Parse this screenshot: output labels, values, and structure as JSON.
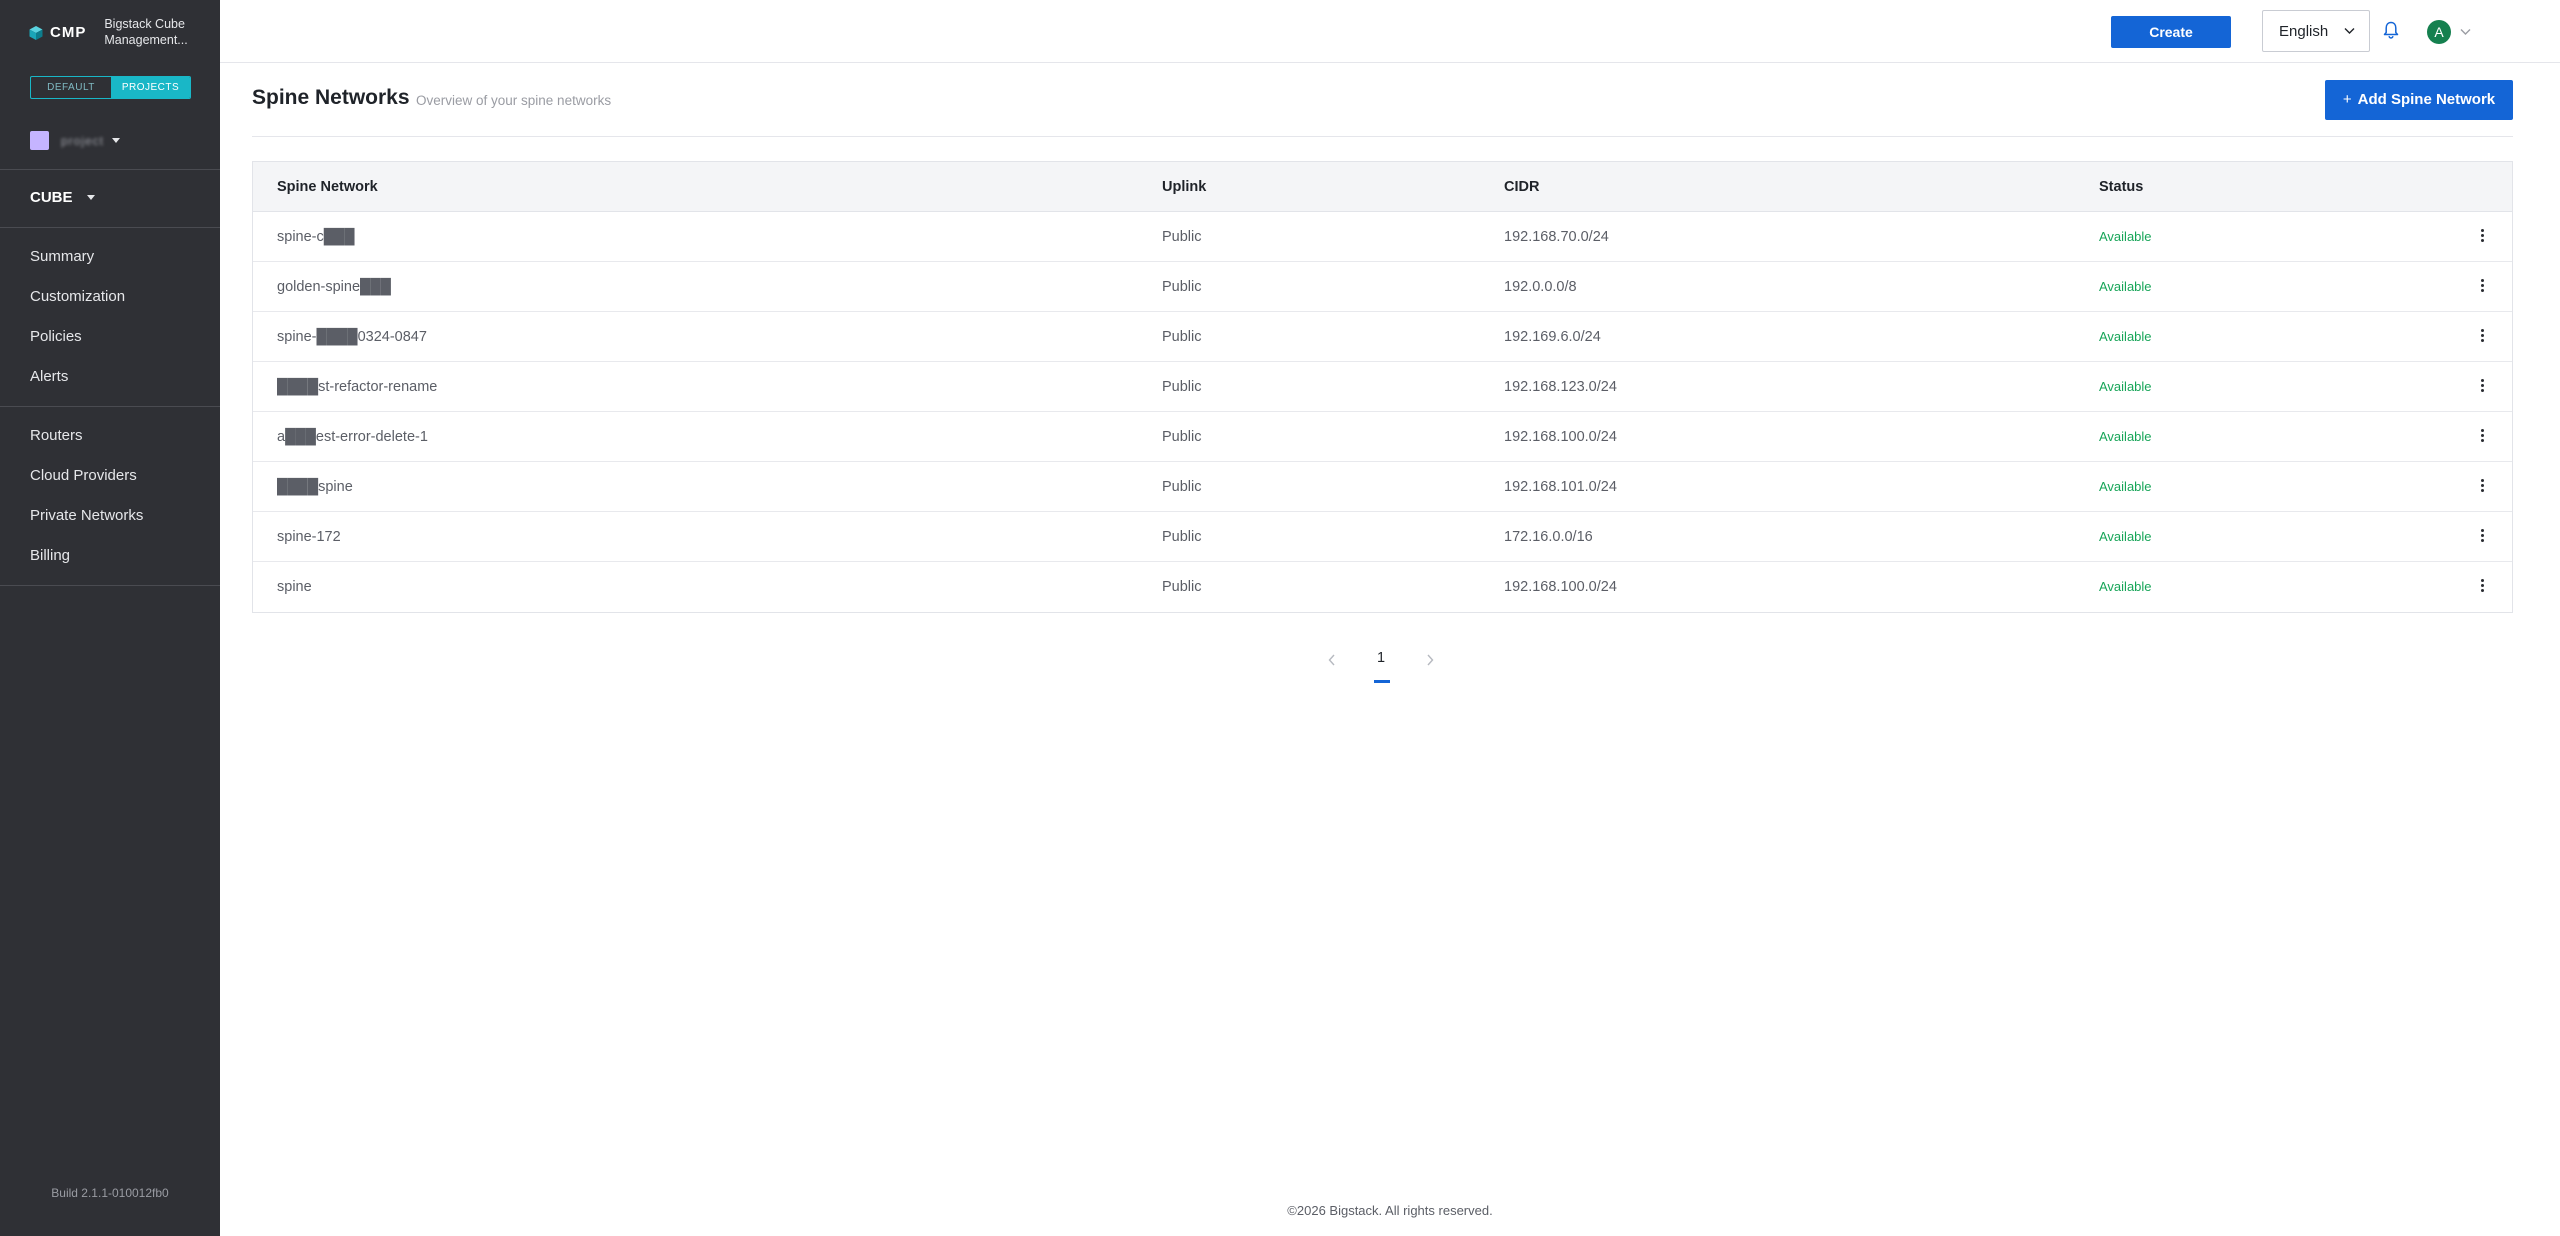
{
  "sidebar": {
    "brand": {
      "logo_text": "CMP",
      "app_name": "Bigstack Cube Management..."
    },
    "scope": {
      "default_label": "DEFAULT",
      "projects_label": "PROJECTS"
    },
    "project": {
      "name": "project",
      "swatch_color": "#c5b4ff"
    },
    "cube_selector": "CUBE",
    "nav_group_1": [
      {
        "label": "Summary"
      },
      {
        "label": "Customization"
      },
      {
        "label": "Policies"
      },
      {
        "label": "Alerts"
      }
    ],
    "nav_group_2": [
      {
        "label": "Routers"
      },
      {
        "label": "Cloud Providers"
      },
      {
        "label": "Private Networks"
      },
      {
        "label": "Billing"
      }
    ],
    "build": "Build 2.1.1-010012fb0"
  },
  "header": {
    "create_label": "Create",
    "language": "English",
    "avatar_initial": "A"
  },
  "page": {
    "title": "Spine Networks",
    "subtitle": "Overview of your spine networks",
    "add_label": "Add Spine Network"
  },
  "table": {
    "columns": [
      "Spine Network",
      "Uplink",
      "CIDR",
      "Status"
    ],
    "rows": [
      {
        "name": "spine-c███",
        "uplink": "Public",
        "cidr": "192.168.70.0/24",
        "status": "Available"
      },
      {
        "name": "golden-spine███",
        "uplink": "Public",
        "cidr": "192.0.0.0/8",
        "status": "Available"
      },
      {
        "name": "spine-████0324-0847",
        "uplink": "Public",
        "cidr": "192.169.6.0/24",
        "status": "Available"
      },
      {
        "name": "████st-refactor-rename",
        "uplink": "Public",
        "cidr": "192.168.123.0/24",
        "status": "Available"
      },
      {
        "name": "a███est-error-delete-1",
        "uplink": "Public",
        "cidr": "192.168.100.0/24",
        "status": "Available"
      },
      {
        "name": "████spine",
        "uplink": "Public",
        "cidr": "192.168.101.0/24",
        "status": "Available"
      },
      {
        "name": "spine-172",
        "uplink": "Public",
        "cidr": "172.16.0.0/16",
        "status": "Available"
      },
      {
        "name": "spine",
        "uplink": "Public",
        "cidr": "192.168.100.0/24",
        "status": "Available"
      }
    ]
  },
  "pagination": {
    "current_page": "1"
  },
  "footer": {
    "copyright": "©2026 Bigstack. All rights reserved."
  },
  "colors": {
    "sidebar_bg": "#2f3035",
    "primary": "#1465d6",
    "accent_teal": "#19b7c7",
    "status_available": "#17a558",
    "avatar_bg": "#15804f"
  },
  "icons": {
    "logo": "cube-logo-icon",
    "language_chevron": "chevron-down-icon",
    "notifications": "bell-icon",
    "avatar_menu": "chevron-down-icon",
    "row_actions": "kebab-menu-icon",
    "pager_prev": "chevron-left-icon",
    "pager_next": "chevron-right-icon",
    "add": "plus-icon"
  }
}
